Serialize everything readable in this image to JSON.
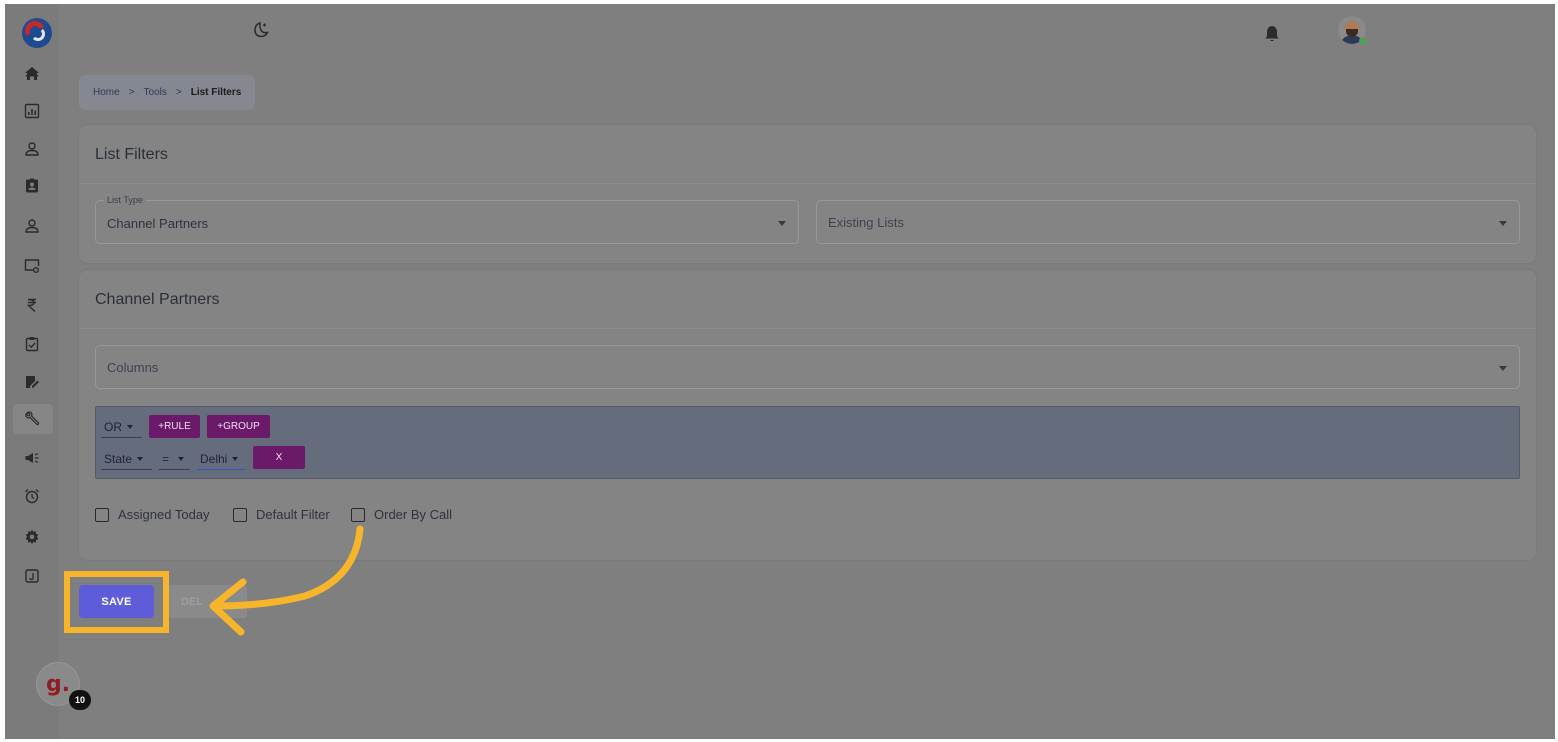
{
  "sidebar": {
    "items": [
      {
        "icon": "home-icon"
      },
      {
        "icon": "chart-icon"
      },
      {
        "icon": "user-icon"
      },
      {
        "icon": "id-badge-icon"
      },
      {
        "icon": "user-icon"
      },
      {
        "icon": "monitor-settings-icon"
      },
      {
        "icon": "rupee-icon"
      },
      {
        "icon": "clipboard-check-icon"
      },
      {
        "icon": "edit-icon"
      },
      {
        "icon": "tools-icon"
      },
      {
        "icon": "megaphone-icon"
      },
      {
        "icon": "alarm-clock-icon"
      },
      {
        "icon": "gear-icon"
      },
      {
        "icon": "journal-icon"
      }
    ],
    "grammarly_letter": "g.",
    "grammarly_badge": "10"
  },
  "header": {
    "theme_icon": "moon-icon",
    "notification_icon": "bell-icon"
  },
  "breadcrumb": {
    "home": "Home",
    "sep": ">",
    "tools": "Tools",
    "current": "List Filters"
  },
  "list_filters_card": {
    "title": "List Filters",
    "list_type_label": "List Type",
    "list_type_value": "Channel Partners",
    "existing_lists_placeholder": "Existing Lists"
  },
  "channel_card": {
    "title": "Channel Partners",
    "columns_placeholder": "Columns",
    "query_builder": {
      "combinator": "OR",
      "add_rule": "+RULE",
      "add_group": "+GROUP",
      "rule": {
        "field": "State",
        "operator": "=",
        "value": "Delhi",
        "remove": "X"
      }
    },
    "checkboxes": [
      {
        "label": "Assigned Today",
        "checked": false
      },
      {
        "label": "Default Filter",
        "checked": false
      },
      {
        "label": "Order By Call",
        "checked": false
      }
    ]
  },
  "actions": {
    "save": "SAVE",
    "delete": "DEL"
  },
  "colors": {
    "accent": "#5e5cd8",
    "query_button": "#6b1a6a",
    "highlight": "#f6b52a"
  }
}
